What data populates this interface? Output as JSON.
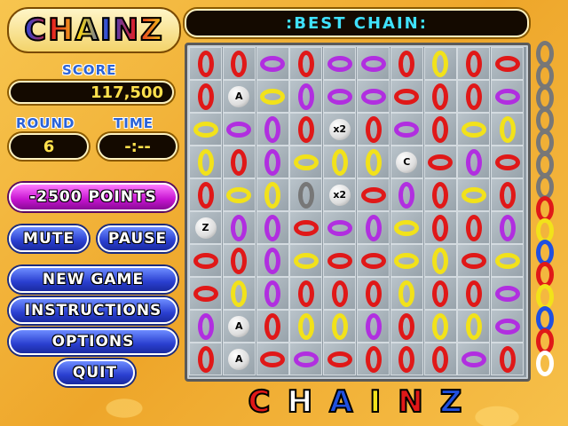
{
  "logo": {
    "text": "CHAINZ"
  },
  "score": {
    "label": "SCORE",
    "value": "117,500"
  },
  "round": {
    "label": "ROUND",
    "value": "6"
  },
  "time": {
    "label": "TIME",
    "value": "-:--"
  },
  "points_banner": "-2500 POINTS",
  "buttons": {
    "mute": "MUTE",
    "pause": "PAUSE",
    "new_game": "NEW GAME",
    "instructions": "INSTRUCTIONS",
    "options": "OPTIONS",
    "quit": "QUIT"
  },
  "best_chain": {
    "label": ":BEST CHAIN:"
  },
  "bottom_logo": "CHAINZ",
  "colors": {
    "red": "#e01818",
    "yellow": "#f2e21a",
    "purple": "#b12ee0",
    "gray": "#777777",
    "white": "#ffffff",
    "blue": "#2050e0"
  },
  "board": {
    "rows": [
      [
        "Rv",
        "Rv",
        "Ph",
        "Rv",
        "Ph",
        "Ph",
        "Rv",
        "Yv",
        "Rv",
        "Rh"
      ],
      [
        "Rv",
        "A",
        "Yh",
        "Pv",
        "Ph",
        "Ph",
        "Rh",
        "Rv",
        "Rv",
        "Ph"
      ],
      [
        "Yh",
        "Ph",
        "Pv",
        "Rv",
        "x2",
        "Rv",
        "Ph",
        "Rv",
        "Yh",
        "Yv"
      ],
      [
        "Yv",
        "Rv",
        "Pv",
        "Yh",
        "Yv",
        "Yv",
        "C",
        "Rh",
        "Pv",
        "Rh"
      ],
      [
        "Rv",
        "Yh",
        "Yv",
        "Gv",
        "x2b",
        "Rh",
        "Pv",
        "Rv",
        "Yh",
        "Rv"
      ],
      [
        "Z",
        "Pv",
        "Pv",
        "Rh",
        "Ph",
        "Pv",
        "Yh",
        "Rv",
        "Rv",
        "Pv"
      ],
      [
        "Rh",
        "Rv",
        "Pv",
        "Yh",
        "Rh",
        "Rh",
        "Yh",
        "Yv",
        "Rh",
        "Yh"
      ],
      [
        "Rh",
        "Yv",
        "Pv",
        "Rv",
        "Rv",
        "Rv",
        "Yv",
        "Rv",
        "Rv",
        "Ph"
      ],
      [
        "Pv",
        "A",
        "Rv",
        "Yv",
        "Yv",
        "Pv",
        "Rv",
        "Yv",
        "Yv",
        "Ph"
      ],
      [
        "Rv",
        "A",
        "Rh",
        "Ph",
        "Rh",
        "Rv",
        "Rv",
        "Rv",
        "Ph",
        "Rv"
      ]
    ],
    "ball_labels": {
      "A": "A",
      "x2": "x2",
      "x2b": "x2",
      "C": "C",
      "Z": "Z"
    }
  },
  "side_chain": [
    "gray",
    "gray",
    "gray",
    "gray",
    "gray",
    "gray",
    "gray",
    "red",
    "yellow",
    "blue",
    "red",
    "yellow",
    "blue",
    "red",
    "white"
  ]
}
